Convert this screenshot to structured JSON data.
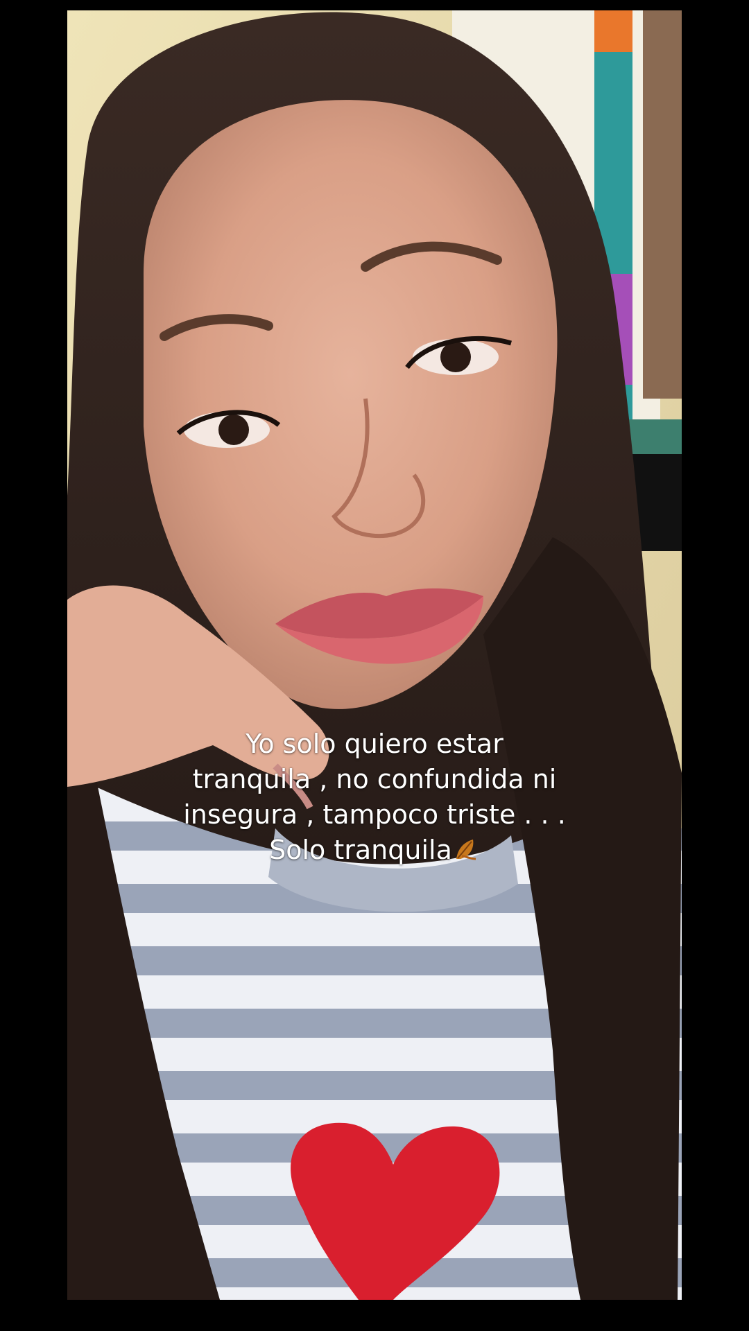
{
  "caption": {
    "lines": [
      "Yo solo quiero estar",
      "tranquila , no confundida ni",
      "insegura , tampoco triste . . .",
      "Solo tranquila"
    ],
    "emoji_icon": "fallen-leaf-icon"
  },
  "colors": {
    "letterbox": "#000000",
    "caption_text": "#ffffff",
    "sweater_stripe": "#9aa4b8",
    "heart_patch": "#d91f2e"
  }
}
